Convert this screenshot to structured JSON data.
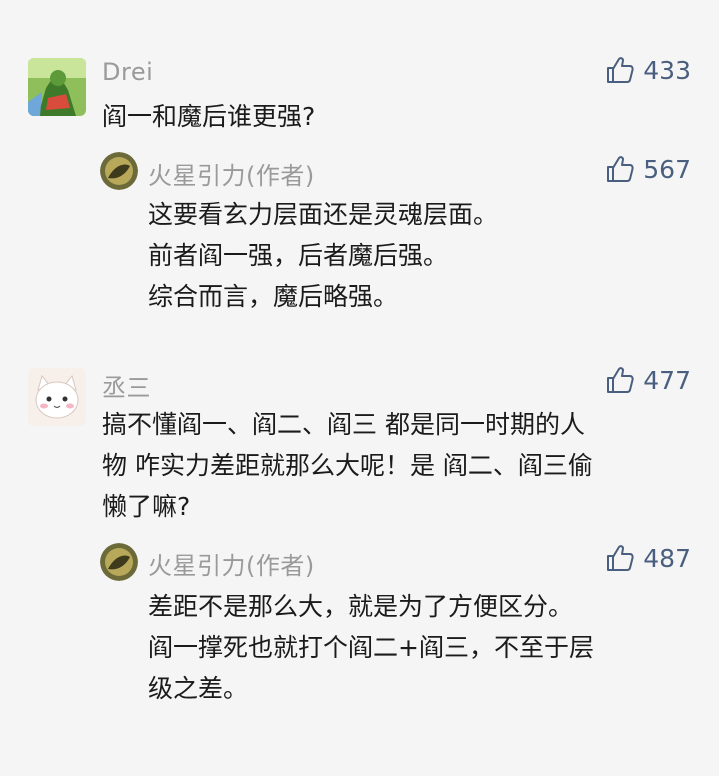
{
  "comments": [
    {
      "user": "Drei",
      "avatar_icon": "green-warrior-avatar",
      "text": "阎一和魔后谁更强?",
      "likes": "433",
      "reply": {
        "user": "火星引力(作者)",
        "avatar_icon": "gold-circle-avatar",
        "lines": [
          "这要看玄力层面还是灵魂层面。",
          "前者阎一强，后者魔后强。",
          "综合而言，魔后略强。"
        ],
        "likes": "567"
      }
    },
    {
      "user": "丞三",
      "avatar_icon": "cat-avatar",
      "lines": [
        "搞不懂阎一、阎二、阎三 都是同一时期的人",
        "物 咋实力差距就那么大呢！是 阎二、阎三偷",
        "懒了嘛?"
      ],
      "likes": "477",
      "reply": {
        "user": "火星引力(作者)",
        "avatar_icon": "gold-circle-avatar",
        "lines": [
          "差距不是那么大，就是为了方便区分。",
          "阎一撑死也就打个阎二+阎三，不至于层",
          "级之差。"
        ],
        "likes": "487"
      }
    }
  ],
  "colors": {
    "name": "#9a9a9a",
    "text": "#1b1b1b",
    "like": "#4a5f7f",
    "background": "#f5f5f5"
  },
  "like_icon": "thumbs-up-icon"
}
